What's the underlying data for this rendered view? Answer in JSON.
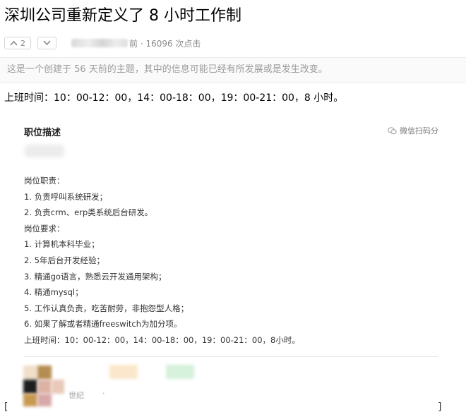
{
  "topic": {
    "title": "深圳公司重新定义了 8 小时工作制",
    "upvote_count": "2",
    "meta_text": "前 · 16096 次点击",
    "notice": "这是一个创建于 56 天前的主题，其中的信息可能已经有所发展或是发生改变。",
    "work_time": "上班时间：10：00-12：00，14：00-18：00，19：00-21：00，8 小时。"
  },
  "job_image": {
    "heading": "职位描述",
    "share_label": "微信扫码分",
    "lines": [
      "岗位职责：",
      "1. 负责呼叫系统研发；",
      "2. 负责crm、erp类系统后台研发。",
      "岗位要求：",
      "1. 计算机本科毕业；",
      "2. 5年后台开发经验；",
      "3. 精通go语言，熟悉云开发通用架构；",
      "4. 精通mysql；",
      "5. 工作认真负责，吃苦耐劳，非抱怨型人格；",
      "6. 如果了解或者精通freeswitch为加分项。",
      "上班时间：10：00-12：00，14：00-18：00，19：00-21：00，8小时。"
    ],
    "poster_name": "世纪",
    "poster_extra": "·"
  },
  "brackets": {
    "left": "[",
    "right": "]"
  },
  "colors": {
    "meta_gray": "#8a8a8a",
    "notice_bg": "#fafafa",
    "notice_text": "#9b9b9b",
    "job_text": "#333333"
  },
  "icons": {
    "upvote": "chevron-up-icon",
    "downvote": "chevron-down-icon",
    "share": "wechat-icon"
  }
}
